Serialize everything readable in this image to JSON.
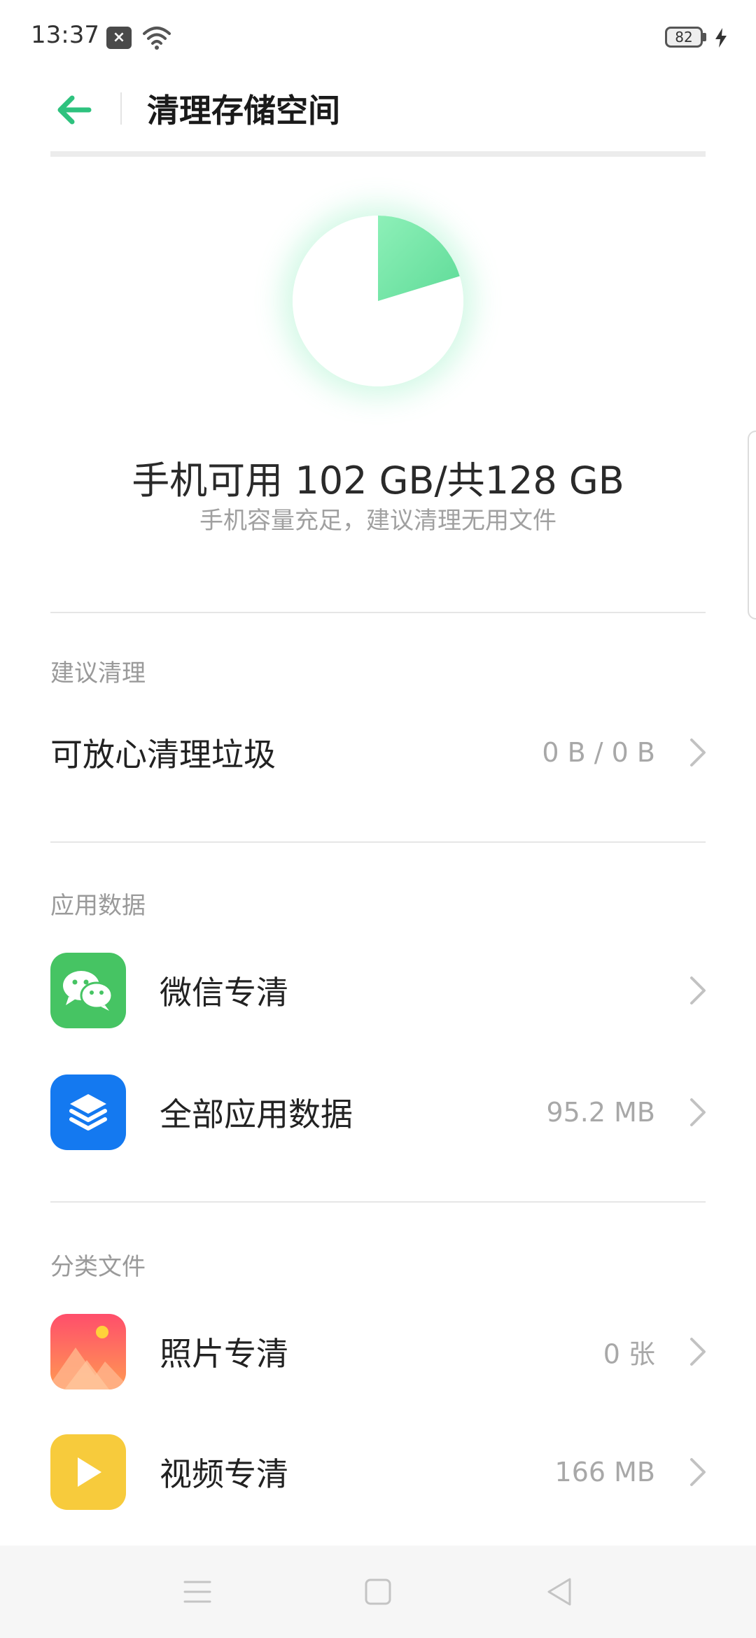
{
  "status_bar": {
    "time": "13:37",
    "battery_level": "82",
    "icons": [
      "notification-x-icon",
      "wifi-icon",
      "battery-icon",
      "charging-bolt-icon"
    ]
  },
  "header": {
    "title": "清理存储空间"
  },
  "storage": {
    "summary": "手机可用 102 GB/共128 GB",
    "subtitle": "手机容量充足，建议清理无用文件",
    "used_fraction": 0.203,
    "used_color": "#6FE3A2",
    "free_color": "#ffffff"
  },
  "sections": {
    "suggested": {
      "header": "建议清理",
      "items": [
        {
          "label": "可放心清理垃圾",
          "value": "0 B / 0 B"
        }
      ]
    },
    "app_data": {
      "header": "应用数据",
      "items": [
        {
          "label": "微信专清",
          "value": "",
          "icon": "wechat-icon"
        },
        {
          "label": "全部应用数据",
          "value": "95.2 MB",
          "icon": "layers-icon"
        }
      ]
    },
    "files": {
      "header": "分类文件",
      "items": [
        {
          "label": "照片专清",
          "value": "0 张",
          "icon": "photo-icon"
        },
        {
          "label": "视频专清",
          "value": "166 MB",
          "icon": "play-icon"
        }
      ]
    }
  },
  "colors": {
    "accent": "#2EC27E",
    "wechat": "#46C463",
    "layers": "#1479F0",
    "photo_top": "#FF4E6B",
    "photo_bottom": "#FF9A52",
    "video": "#F7CB3C"
  }
}
